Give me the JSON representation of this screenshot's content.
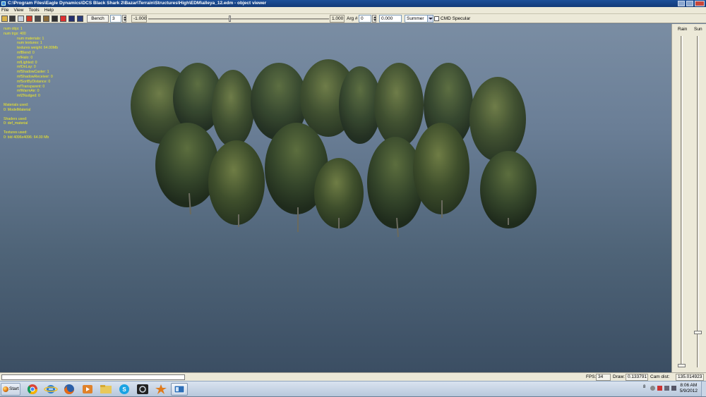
{
  "window": {
    "title": "C:\\Program Files\\Eagle Dynamics\\DCS Black Shark 2\\Bazar\\Terrain\\Structures\\High\\EDM\\alleya_12.edm - object viewer"
  },
  "menu": [
    "File",
    "View",
    "Tools",
    "Help"
  ],
  "toolbar": {
    "bench_label": "Bench",
    "bench_value": "3",
    "slider_min": "-1.000",
    "slider_max": "1.000",
    "slider_level": 0.45,
    "arg_label": "Arg #",
    "arg_value": "0",
    "arg_result": "0.000",
    "season": "Summer",
    "cmd_specular_label": "CMD Specular",
    "cmd_specular_checked": false
  },
  "stats": {
    "num_objs": "num objs: 1",
    "num_trgs": "num trgs: 400",
    "num_materials": "num materials: 1",
    "num_textures": "num textures: 1",
    "textures_weight": "textures weight: 64.00Mb",
    "mfBlend": "mfBlend: 0",
    "mfHalo": "mfHalo: 0",
    "mfLighted": "mfLighted: 0",
    "mfOnLay": "mfOnLay: 0",
    "mfShadowCaster": "mfShadowCaster: 1",
    "mfShadowReceiver": "mfShadowReceiver: 0",
    "mfSortByDistance": "mfSortByDistance: 0",
    "mfTransparent": "mfTransparent: 0",
    "mfWarmAir": "mfWarmAir: 0",
    "mfZNudged": "mfZNudged: 0",
    "materials_header": "Materials used:",
    "materials_0": "0: ModelMaterial",
    "shaders_header": "Shaders used:",
    "shaders_0": "0: def_material",
    "textures_header": "Textures used:",
    "textures_0": "0: bld 4096x4096: 64.00 Mb"
  },
  "side_panel": {
    "rain_label": "Rain",
    "sun_label": "Sun",
    "rain_level": 0.0,
    "sun_level": 0.1
  },
  "status": {
    "fps_label": "FPS:",
    "fps_value": "34",
    "draw_label": "Draw:",
    "draw_value": "0.133791",
    "camdist_label": "Cam dist:",
    "camdist_value": "135.014923"
  },
  "taskbar": {
    "start_label": "Start",
    "apps": [
      "chrome-icon",
      "internet-explorer-icon",
      "firefox-icon",
      "media-player-icon",
      "file-explorer-icon",
      "skype-icon",
      "steam-icon",
      "paint-icon",
      "object-viewer-icon"
    ],
    "time": "8:06 AM",
    "date": "5/9/2012"
  },
  "colors": {
    "stats_text": "#f2ea26",
    "foliage_dark": "#26331f",
    "foliage_light": "#6f7d45"
  }
}
